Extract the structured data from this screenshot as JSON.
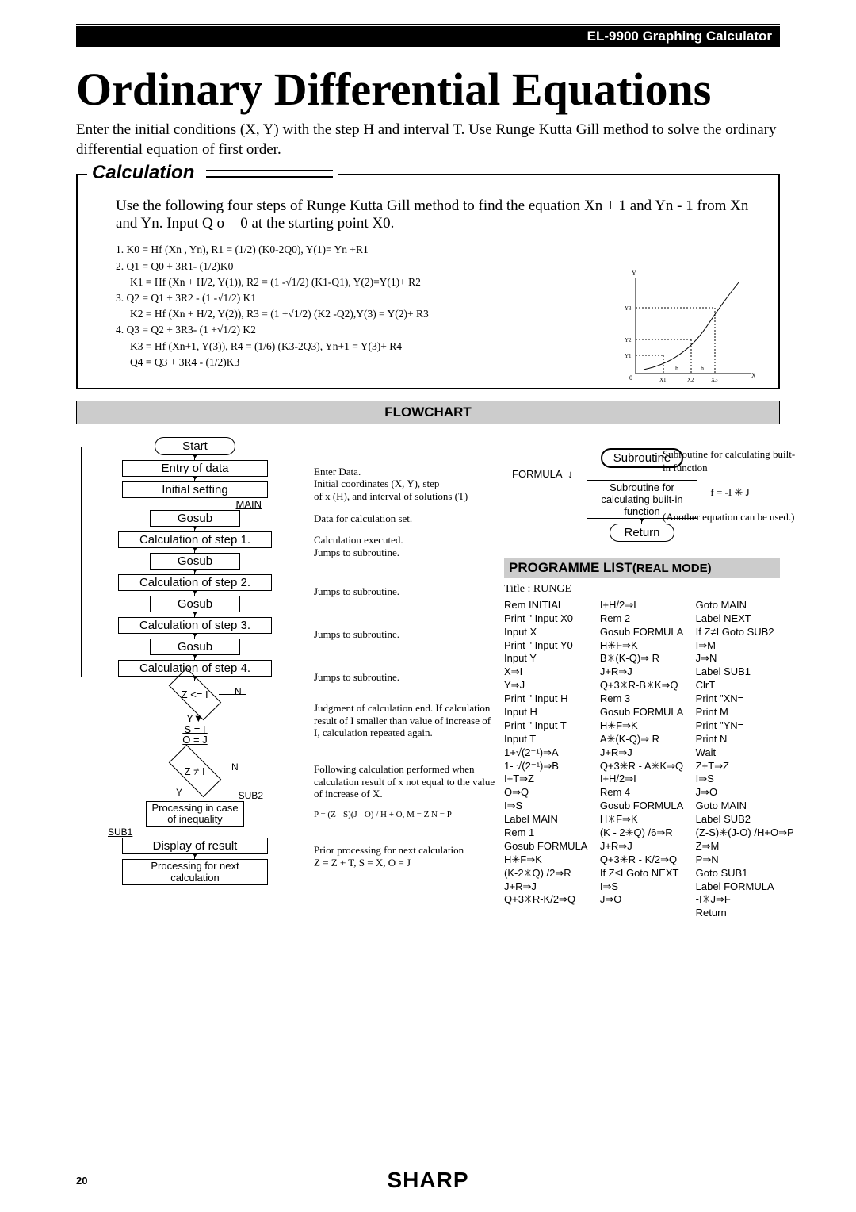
{
  "header": {
    "product": "EL-9900 Graphing Calculator"
  },
  "title": "Ordinary Differential Equations",
  "intro": "Enter the initial conditions (X, Y) with the step H and interval T. Use Runge Kutta Gill method to solve the ordinary differential equation of first order.",
  "calculation": {
    "heading": "Calculation",
    "body": "Use the following four steps of Runge Kutta Gill method to find the equation  Xn + 1 and Yn - 1 from Xn and Yn. Input Q o = 0 at the starting point X0.",
    "steps": [
      "1. K0 = Hf (Xn , Yn), R1 = (1/2) (K0-2Q0), Y(1)= Yn +R1",
      "2. Q1 = Q0 + 3R1- (1/2)K0",
      "    K1 = Hf (Xn + H/2, Y(1)), R2 = (1 -√1/2) (K1-Q1), Y(2)=Y(1)+ R2",
      "3. Q2 = Q1 + 3R2 - (1 -√1/2) K1",
      "    K2 = Hf (Xn + H/2, Y(2)), R3 = (1 +√1/2) (K2 -Q2),Y(3) = Y(2)+ R3",
      "4. Q3 = Q2 + 3R3- (1 +√1/2) K2",
      "    K3 = Hf (Xn+1, Y(3)), R4 = (1/6) (K3-2Q3), Yn+1 = Y(3)+ R4",
      "    Q4 = Q3 + 3R4 - (1/2)K3"
    ],
    "plot_labels": {
      "y": "Y",
      "x": "X",
      "o": "0",
      "h": "h",
      "x1": "X1",
      "x2": "X2",
      "x3": "X3",
      "y1": "Y1",
      "y2": "Y2",
      "y3": "Y3"
    }
  },
  "flow_hdr": "FLOWCHART",
  "flowchart": {
    "start": "Start",
    "entry": "Entry of data",
    "init": "Initial setting",
    "main": "MAIN",
    "gosub": "Gosub",
    "s1": "Calculation of step 1.",
    "s2": "Calculation of step 2.",
    "s3": "Calculation of step 3.",
    "s4": "Calculation of step 4.",
    "dz": "Z <= I",
    "yi": "Y▼",
    "si": "S = I",
    "oj": "O = J",
    "dz2": "Z ≠ I",
    "sub2": "SUB2",
    "proc": "Processing in case of inequality",
    "sub1": "SUB1",
    "disp": "Display of result",
    "next": "Processing for next calculation",
    "N": "N",
    "Y": "Y"
  },
  "flow_notes": {
    "n1": "Enter Data.\n  Initial coordinates (X, Y), step\n  of x (H), and interval of solutions (T)",
    "n2": "Data for calculation set.",
    "n3": "Calculation executed.\nJumps to subroutine.",
    "n4": "Jumps to subroutine.",
    "n5": "Jumps to subroutine.",
    "n6": "Jumps to subroutine.",
    "n7": "Judgment of calculation end.\nIf calculation result of I smaller than value of increase of I, calculation repeated again.",
    "n8": "Following calculation performed when calculation result of x not equal to the value of increase of X.",
    "n8f": "P = (Z - S)(J - O) / H + O,  M = Z  N = P",
    "n9": "Prior processing for next calculation\nZ = Z + T, S = X, O = J"
  },
  "subroutine": {
    "title": "Subroutine",
    "formula": "FORMULA",
    "box": "Subroutine for calculating built-in function",
    "ret": "Return",
    "note1": "Subroutine for calculating built-in function",
    "fn": "f = -I ✳ J",
    "note2": "(Another equation can be used.)"
  },
  "programme_list": {
    "heading_a": "PROGRAMME LIST",
    "heading_b": "(REAL MODE)",
    "title": "Title : RUNGE",
    "col1": "Rem INITIAL\nPrint \" Input X0\nInput X\nPrint \" Input Y0\nInput Y\nX⇒I\nY⇒J\nPrint \" Input H\nInput H\nPrint \" Input T\nInput T\n1+√(2⁻¹)⇒A\n1- √(2⁻¹)⇒B\nI+T⇒Z\nO⇒Q\nI⇒S\nLabel MAIN\nRem 1\nGosub FORMULA\nH✳F⇒K\n(K-2✳Q) /2⇒R\nJ+R⇒J\nQ+3✳R-K/2⇒Q",
    "col2": "I+H/2⇒I\nRem 2\nGosub FORMULA\nH✳F⇒K\nB✳(K-Q)⇒ R\nJ+R⇒J\nQ+3✳R-B✳K⇒Q\nRem 3\nGosub FORMULA\nH✳F⇒K\nA✳(K-Q)⇒ R\nJ+R⇒J\nQ+3✳R - A✳K⇒Q\nI+H/2⇒I\nRem 4\nGosub FORMULA\nH✳F⇒K\n(K - 2✳Q) /6⇒R\nJ+R⇒J\nQ+3✳R - K/2⇒Q\nIf Z≤I Goto NEXT\nI⇒S\nJ⇒O",
    "col3": "Goto MAIN\nLabel NEXT\nIf Z≠I Goto SUB2\nI⇒M\nJ⇒N\nLabel SUB1\nClrT\nPrint \"XN=\nPrint M\nPrint \"YN=\nPrint N\nWait\nZ+T⇒Z\nI⇒S\nJ⇒O\nGoto MAIN\nLabel SUB2\n(Z-S)✳(J-O) /H+O⇒P\nZ⇒M\nP⇒N\nGoto SUB1\nLabel FORMULA\n-I✳J⇒F\nReturn"
  },
  "page_number": "20",
  "brand": "SHARP"
}
